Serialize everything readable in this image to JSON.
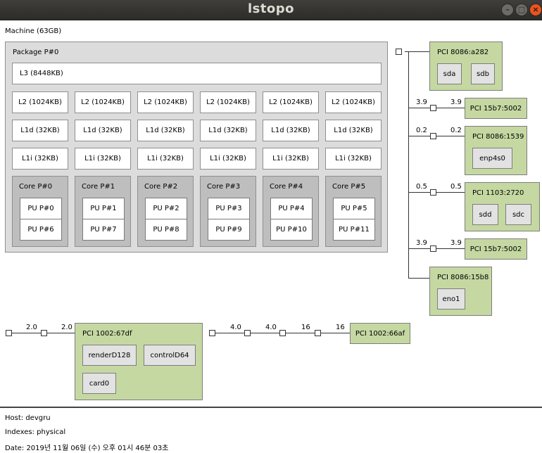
{
  "window": {
    "title": "lstopo"
  },
  "machine": {
    "label": "Machine (63GB)"
  },
  "package": {
    "label": "Package P#0",
    "l3": "L3 (8448KB)",
    "l2": [
      "L2 (1024KB)",
      "L2 (1024KB)",
      "L2 (1024KB)",
      "L2 (1024KB)",
      "L2 (1024KB)",
      "L2 (1024KB)"
    ],
    "l1d": [
      "L1d (32KB)",
      "L1d (32KB)",
      "L1d (32KB)",
      "L1d (32KB)",
      "L1d (32KB)",
      "L1d (32KB)"
    ],
    "l1i": [
      "L1i (32KB)",
      "L1i (32KB)",
      "L1i (32KB)",
      "L1i (32KB)",
      "L1i (32KB)",
      "L1i (32KB)"
    ],
    "cores": [
      {
        "label": "Core P#0",
        "pu": [
          "PU P#0",
          "PU P#6"
        ]
      },
      {
        "label": "Core P#1",
        "pu": [
          "PU P#1",
          "PU P#7"
        ]
      },
      {
        "label": "Core P#2",
        "pu": [
          "PU P#2",
          "PU P#8"
        ]
      },
      {
        "label": "Core P#3",
        "pu": [
          "PU P#3",
          "PU P#9"
        ]
      },
      {
        "label": "Core P#4",
        "pu": [
          "PU P#4",
          "PU P#10"
        ]
      },
      {
        "label": "Core P#5",
        "pu": [
          "PU P#5",
          "PU P#11"
        ]
      }
    ]
  },
  "pci_right": [
    {
      "label": "PCI 8086:a282",
      "children": [
        "sda",
        "sdb"
      ],
      "bw_left": "",
      "bw_right": ""
    },
    {
      "label": "PCI 15b7:5002",
      "children": [],
      "bw_left": "3.9",
      "bw_right": "3.9"
    },
    {
      "label": "PCI 8086:1539",
      "children": [
        "enp4s0"
      ],
      "bw_left": "0.2",
      "bw_right": "0.2"
    },
    {
      "label": "PCI 1103:2720",
      "children": [
        "sdd",
        "sdc"
      ],
      "bw_left": "0.5",
      "bw_right": "0.5"
    },
    {
      "label": "PCI 15b7:5002",
      "children": [],
      "bw_left": "3.9",
      "bw_right": "3.9"
    },
    {
      "label": "PCI 8086:15b8",
      "children": [
        "eno1"
      ],
      "bw_left": "",
      "bw_right": ""
    }
  ],
  "pci_bottom": {
    "gpu": {
      "label": "PCI 1002:67df",
      "children": [
        "renderD128",
        "controlD64",
        "card0"
      ]
    },
    "bw_a_left": "2.0",
    "bw_a_right": "2.0",
    "other": {
      "label": "PCI 1002:66af"
    },
    "bw_b": [
      "4.0",
      "4.0",
      "16",
      "16"
    ]
  },
  "footer": {
    "host": "Host: devgru",
    "indexes": "Indexes: physical",
    "date": "Date: 2019년 11월 06일 (수) 오후 01시 46분 03초"
  }
}
